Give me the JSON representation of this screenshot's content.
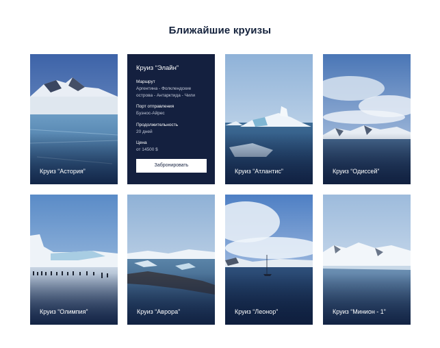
{
  "heading": "Ближайшие круизы",
  "cruises": [
    {
      "name": "Круиз “Астория”"
    },
    {
      "name": "Круиз “Атлантис”"
    },
    {
      "name": "Круиз “Одиссей”"
    },
    {
      "name": "Круиз “Олимпия”"
    },
    {
      "name": "Круиз “Аврора”"
    },
    {
      "name": "Круиз “Леонор”"
    },
    {
      "name": "Круиз “Минион - 1”"
    }
  ],
  "featured": {
    "title": "Круиз “Элайн”",
    "route_label": "Маршрут",
    "route_value": "Аргентина - Фолклендские острова - Антарктида - Чили",
    "port_label": "Порт отправления",
    "port_value": "Буэнос-Айрес",
    "duration_label": "Продолжительность",
    "duration_value": "20 дней",
    "price_label": "Цена",
    "price_value": "от 14500 $",
    "book_button": "Забронировать"
  },
  "colors": {
    "navy": "#14203f",
    "text": "#14223c"
  }
}
